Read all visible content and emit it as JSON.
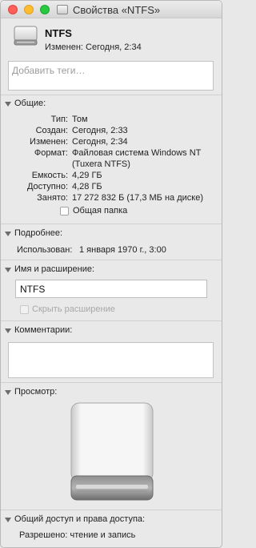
{
  "window": {
    "title": "Свойства «NTFS»"
  },
  "header": {
    "name": "NTFS",
    "modified": "Изменен: Сегодня, 2:34",
    "icon": "external-drive-icon"
  },
  "tags": {
    "placeholder": "Добавить теги…"
  },
  "general": {
    "title": "Общие:",
    "rows": [
      {
        "key": "Тип:",
        "value": "Том"
      },
      {
        "key": "Создан:",
        "value": "Сегодня, 2:33"
      },
      {
        "key": "Изменен:",
        "value": "Сегодня, 2:34"
      },
      {
        "key": "Формат:",
        "value": "Файловая система Windows NT"
      },
      {
        "key": "",
        "value": "(Tuxera NTFS)"
      },
      {
        "key": "Емкость:",
        "value": "4,29 ГБ"
      },
      {
        "key": "Доступно:",
        "value": "4,28 ГБ"
      },
      {
        "key": "Занято:",
        "value": "17 272 832 Б (17,3 МБ на диске)"
      }
    ],
    "shared_folder_label": "Общая папка",
    "shared_folder_checked": false
  },
  "more_info": {
    "title": "Подробнее:",
    "used_label": "Использован:",
    "used_value": "1 января 1970 г., 3:00"
  },
  "name_ext": {
    "title": "Имя и расширение:",
    "name_value": "NTFS",
    "hide_ext_label": "Скрыть расширение",
    "hide_ext_checked": false,
    "hide_ext_enabled": false
  },
  "comments": {
    "title": "Комментарии:",
    "value": ""
  },
  "preview": {
    "title": "Просмотр:"
  },
  "sharing": {
    "title": "Общий доступ и права доступа:",
    "status": "Разрешено: чтение и запись"
  },
  "colors": {
    "close": "#fc5f57",
    "minimize": "#fdbc2e",
    "zoom": "#27c93f"
  }
}
